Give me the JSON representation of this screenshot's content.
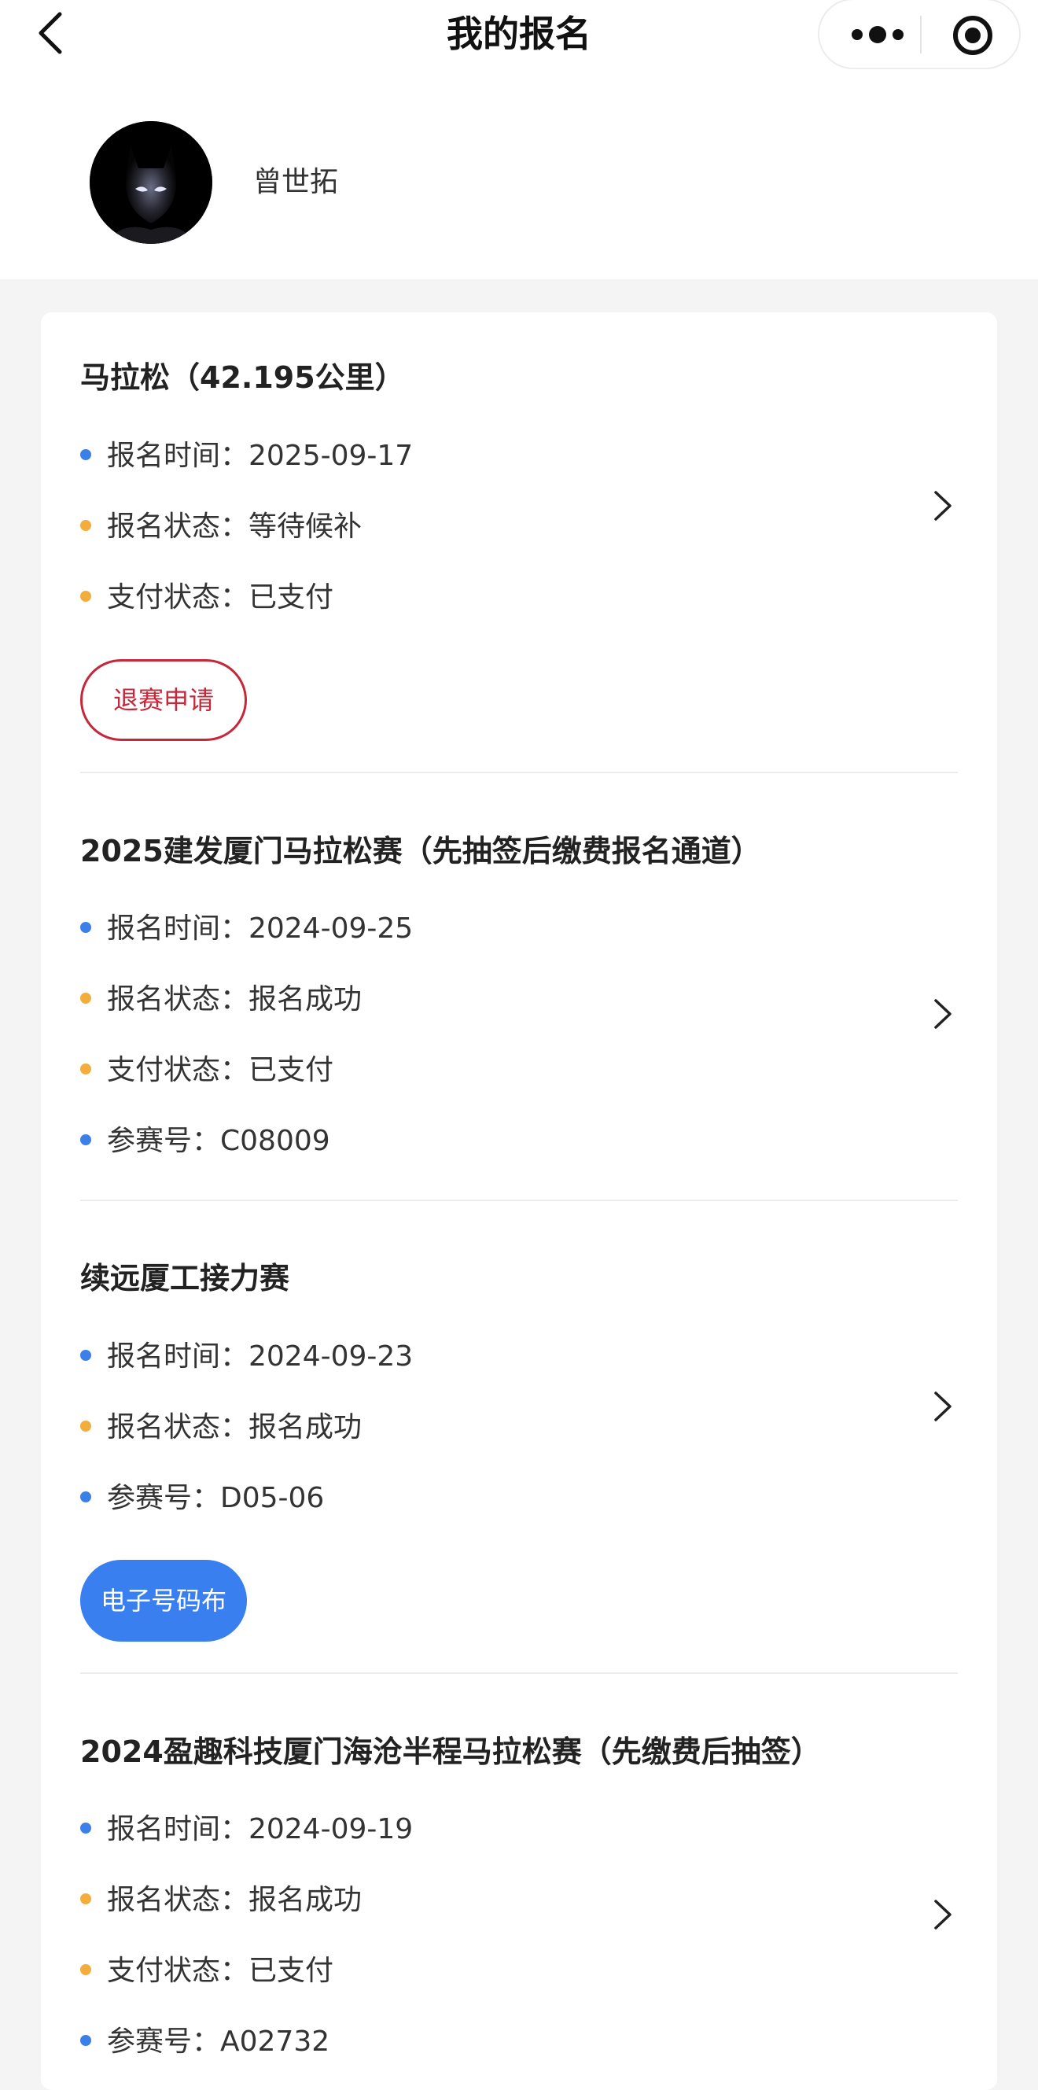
{
  "header": {
    "title": "我的报名",
    "back_icon": "chevron-left-icon",
    "more_icon": "more-dots-icon",
    "target_icon": "target-icon"
  },
  "user": {
    "name": "曾世拓",
    "avatar": "avatar-image"
  },
  "entries": [
    {
      "title": "马拉松（42.195公里）",
      "rows": [
        {
          "label": "报名时间：2025-09-17",
          "dot": "#3d7fe8"
        },
        {
          "label": "报名状态：等待候补",
          "dot": "#f3ad3c"
        },
        {
          "label": "支付状态：已支付",
          "dot": "#f3ad3c"
        }
      ],
      "button": "退赛申请"
    },
    {
      "title": "2025建发厦门马拉松赛（先抽签后缴费报名通道）",
      "rows": [
        {
          "label": "报名时间：2024-09-25",
          "dot": "#3d7fe8"
        },
        {
          "label": "报名状态：报名成功",
          "dot": "#f3ad3c"
        },
        {
          "label": "支付状态：已支付",
          "dot": "#f3ad3c"
        },
        {
          "label": "参赛号：C08009",
          "dot": "#3d7fe8"
        }
      ]
    },
    {
      "title": "续远厦工接力赛",
      "rows": [
        {
          "label": "报名时间：2024-09-23",
          "dot": "#3d7fe8"
        },
        {
          "label": "报名状态：报名成功",
          "dot": "#f3ad3c"
        },
        {
          "label": "参赛号：D05-06",
          "dot": "#3d7fe8"
        }
      ],
      "button": "电子号码布"
    },
    {
      "title": "2024盈趣科技厦门海沧半程马拉松赛（先缴费后抽签）",
      "rows": [
        {
          "label": "报名时间：2024-09-19",
          "dot": "#3d7fe8"
        },
        {
          "label": "报名状态：报名成功",
          "dot": "#f3ad3c"
        },
        {
          "label": "支付状态：已支付",
          "dot": "#f3ad3c"
        },
        {
          "label": "参赛号：A02732",
          "dot": "#3d7fe8"
        }
      ]
    }
  ],
  "colors": {
    "accent_blue": "#3a7ff0",
    "refund_red": "#c4283a",
    "status_orange": "#f3ad3c"
  }
}
